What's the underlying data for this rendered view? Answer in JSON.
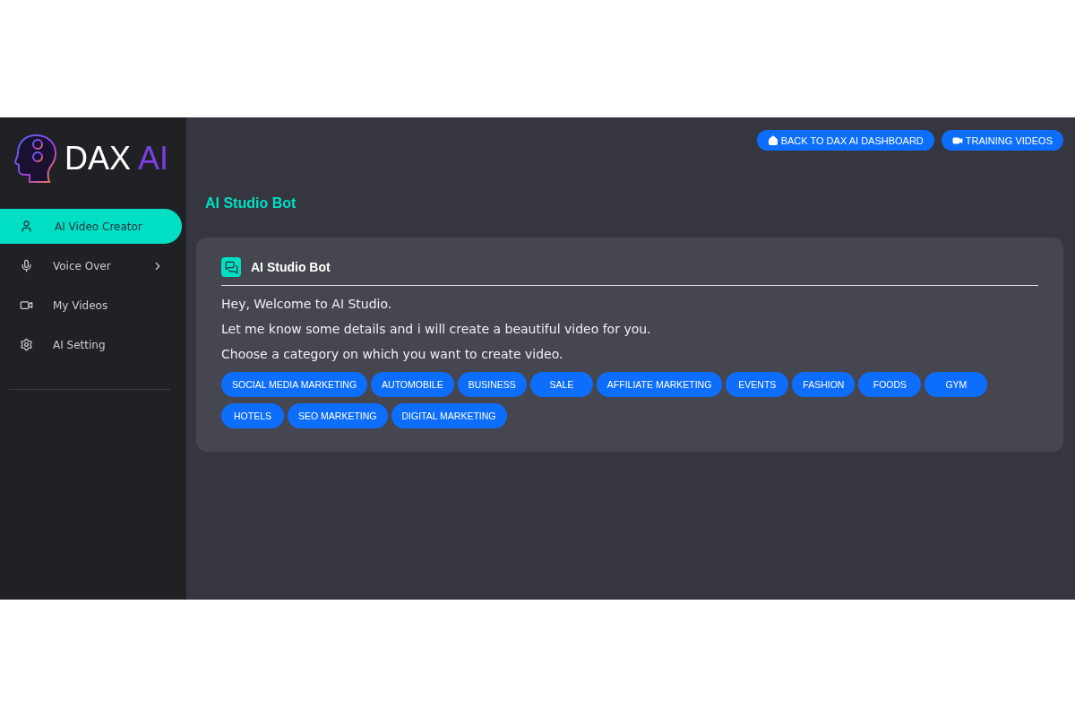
{
  "logo": {
    "text": "DAX",
    "accent": "AI"
  },
  "sidebar": {
    "items": [
      {
        "label": "AI Video Creator",
        "selected": true,
        "submenu": false
      },
      {
        "label": "Voice Over",
        "selected": false,
        "submenu": true
      },
      {
        "label": "My Videos",
        "selected": false,
        "submenu": false
      },
      {
        "label": "AI Setting",
        "selected": false,
        "submenu": false
      }
    ]
  },
  "top_buttons": [
    {
      "label": "BACK TO DAX AI DASHBOARD"
    },
    {
      "label": "TRAINING VIDEOS"
    }
  ],
  "page_title": "AI Studio Bot",
  "card": {
    "title": "AI Studio Bot",
    "messages": [
      "Hey, Welcome to AI Studio.",
      "Let me know some details and i will create a beautiful video for you.",
      "Choose a category on which you want to create video."
    ],
    "categories": [
      "SOCIAL MEDIA MARKETING",
      "AUTOMOBILE",
      "BUSINESS",
      "SALE",
      "AFFILIATE MARKETING",
      "EVENTS",
      "FASHION",
      "FOODS",
      "GYM",
      "HOTELS",
      "SEO MARKETING",
      "DIGITAL MARKETING"
    ]
  }
}
